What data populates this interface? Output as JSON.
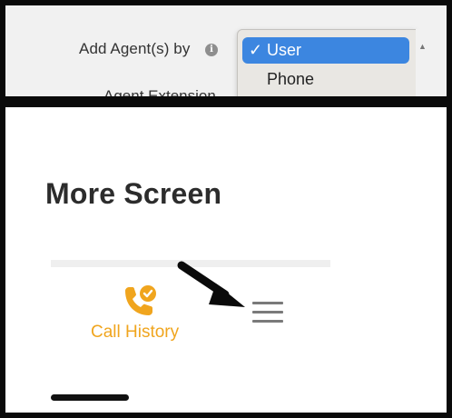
{
  "form": {
    "add_agents_label": "Add Agent(s) by",
    "info_icon": "info-icon",
    "agent_extension_label": "Agent Extension",
    "dropdown": {
      "options": [
        {
          "label": "User",
          "selected": true,
          "check": "✓"
        },
        {
          "label": "Phone",
          "selected": false
        }
      ],
      "selected_color": "#3c86e0"
    }
  },
  "more_screen": {
    "title": "More Screen",
    "tab": {
      "label": "Call History",
      "icon": "call-history-icon",
      "accent_color": "#f0a51e"
    },
    "menu_icon": "hamburger-menu-icon",
    "annotation_arrow": "arrow-pointer"
  }
}
